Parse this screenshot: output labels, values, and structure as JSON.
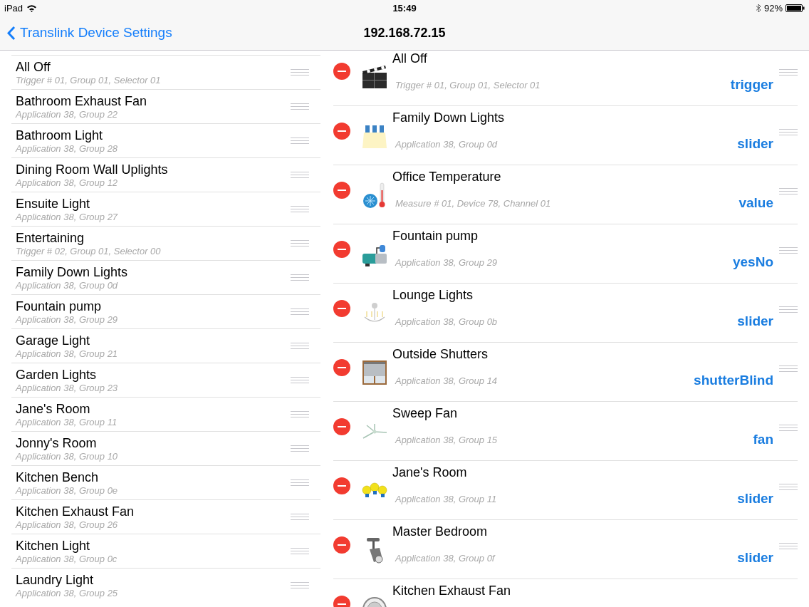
{
  "status_bar": {
    "device": "iPad",
    "time": "15:49",
    "battery": "92%"
  },
  "nav": {
    "back": "Translink Device Settings",
    "title": "192.168.72.15"
  },
  "available": [
    {
      "name": "All Off",
      "detail": "Trigger # 01, Group 01, Selector 01"
    },
    {
      "name": "Bathroom Exhaust Fan",
      "detail": "Application 38, Group 22"
    },
    {
      "name": "Bathroom Light",
      "detail": "Application 38, Group 28"
    },
    {
      "name": "Dining Room Wall Uplights",
      "detail": "Application 38, Group 12"
    },
    {
      "name": "Ensuite Light",
      "detail": "Application 38, Group 27"
    },
    {
      "name": "Entertaining",
      "detail": "Trigger # 02, Group 01, Selector 00"
    },
    {
      "name": "Family Down Lights",
      "detail": "Application 38, Group 0d"
    },
    {
      "name": "Fountain pump",
      "detail": "Application 38, Group 29"
    },
    {
      "name": "Garage Light",
      "detail": "Application 38, Group 21"
    },
    {
      "name": "Garden Lights",
      "detail": "Application 38, Group 23"
    },
    {
      "name": "Jane's Room",
      "detail": "Application 38, Group 11"
    },
    {
      "name": "Jonny's Room",
      "detail": "Application 38, Group 10"
    },
    {
      "name": "Kitchen Bench",
      "detail": "Application 38, Group 0e"
    },
    {
      "name": "Kitchen Exhaust Fan",
      "detail": "Application 38, Group 26"
    },
    {
      "name": "Kitchen Light",
      "detail": "Application 38, Group 0c"
    },
    {
      "name": "Laundry Light",
      "detail": "Application 38, Group 25"
    }
  ],
  "configured": [
    {
      "name": "All Off",
      "detail": "Trigger # 01, Group 01, Selector 01",
      "type": "trigger"
    },
    {
      "name": "Family Down Lights",
      "detail": "Application 38, Group 0d",
      "type": "slider"
    },
    {
      "name": "Office Temperature",
      "detail": "Measure # 01, Device 78, Channel 01",
      "type": "value"
    },
    {
      "name": "Fountain pump",
      "detail": "Application 38, Group 29",
      "type": "yesNo"
    },
    {
      "name": "Lounge Lights",
      "detail": "Application 38, Group 0b",
      "type": "slider"
    },
    {
      "name": "Outside Shutters",
      "detail": "Application 38, Group 14",
      "type": "shutterBlind"
    },
    {
      "name": "Sweep Fan",
      "detail": "Application 38, Group 15",
      "type": "fan"
    },
    {
      "name": "Jane's Room",
      "detail": "Application 38, Group 11",
      "type": "slider"
    },
    {
      "name": "Master Bedroom",
      "detail": "Application 38, Group 0f",
      "type": "slider"
    },
    {
      "name": "Kitchen Exhaust Fan"
    }
  ]
}
